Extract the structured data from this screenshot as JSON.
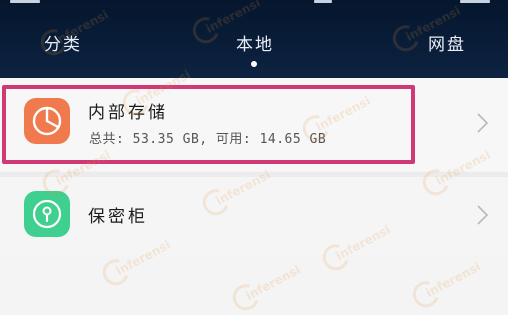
{
  "header": {
    "tabs": [
      {
        "label": "分类"
      },
      {
        "label": "本地"
      },
      {
        "label": "网盘"
      }
    ],
    "active_tab": "本地",
    "background_color": "#0d2341"
  },
  "storage_list": {
    "items": [
      {
        "title": "内部存储",
        "subtitle": "总共: 53.35 GB, 可用: 14.65 GB",
        "icon": "pie-chart-icon",
        "icon_color": "#f07a4e",
        "highlighted": true
      },
      {
        "title": "保密柜",
        "icon": "lock-icon",
        "icon_color": "#3fcf8e"
      }
    ],
    "highlight_color": "#cf3a76"
  },
  "watermark": {
    "label": "inferensi"
  }
}
